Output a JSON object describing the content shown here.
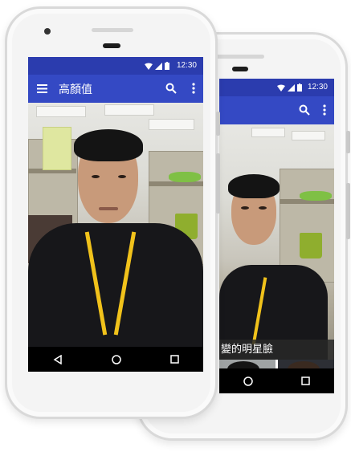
{
  "status_bar": {
    "time": "12:30",
    "icons": [
      "wifi-icon",
      "signal-icon",
      "battery-icon"
    ]
  },
  "app_bar": {
    "title": "高顏值",
    "actions": [
      "search-icon",
      "more-vert-icon"
    ],
    "nav": "menu-icon"
  },
  "back_screen": {
    "status_time": "12:30",
    "result_label": "變的明星臉"
  },
  "nav_bar": {
    "buttons": [
      "back-icon",
      "home-icon",
      "recents-icon"
    ]
  },
  "colors": {
    "status_bar": "#2b3cae",
    "app_bar": "#3449c4",
    "nav_bar": "#000000"
  }
}
